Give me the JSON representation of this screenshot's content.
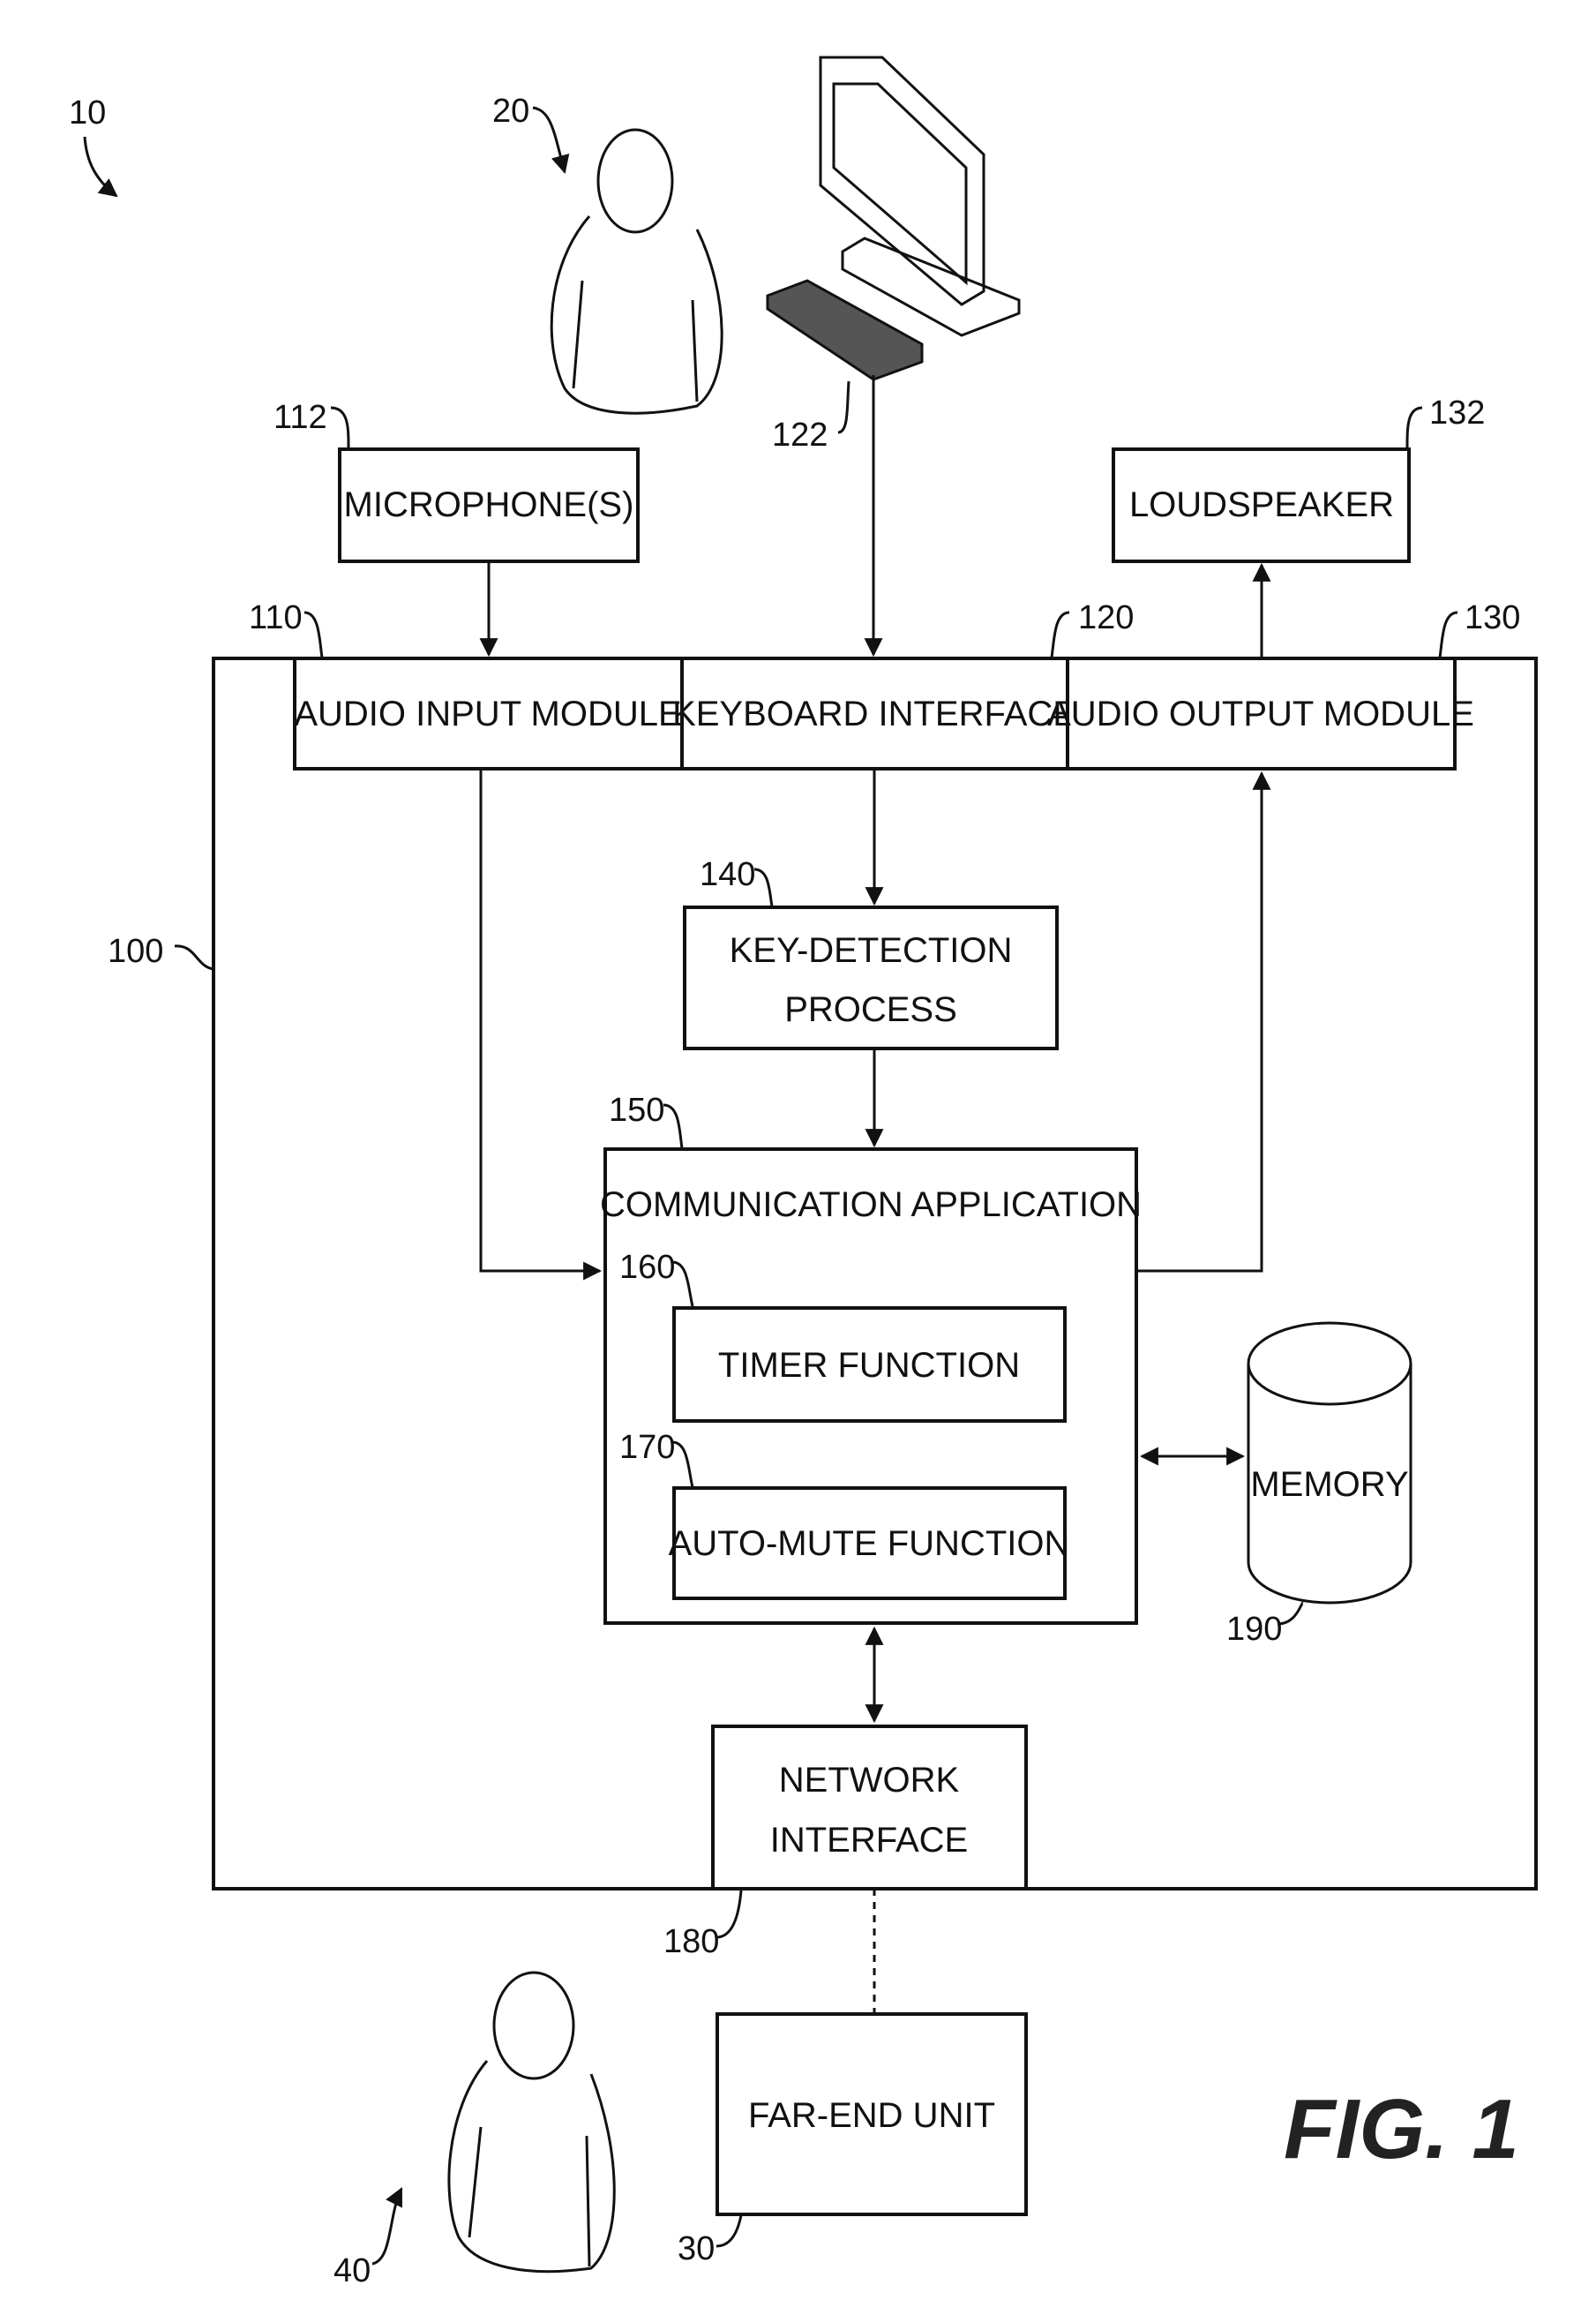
{
  "figure": {
    "title": "FIG. 1",
    "system_ref": "10"
  },
  "actors": {
    "near_end_user": {
      "ref": "20"
    },
    "far_end_user": {
      "ref": "40"
    },
    "computer_keyboard": {
      "ref": "122"
    }
  },
  "blocks": {
    "device": {
      "ref": "100"
    },
    "microphone": {
      "ref": "112",
      "label": "MICROPHONE(S)"
    },
    "loudspeaker": {
      "ref": "132",
      "label": "LOUDSPEAKER"
    },
    "audio_input": {
      "ref": "110",
      "label": "AUDIO INPUT MODULE"
    },
    "keyboard_interface": {
      "ref": "120",
      "label": "KEYBOARD INTERFACE"
    },
    "audio_output": {
      "ref": "130",
      "label": "AUDIO OUTPUT MODULE"
    },
    "key_detection": {
      "ref": "140",
      "line1": "KEY-DETECTION",
      "line2": "PROCESS"
    },
    "communication_app": {
      "ref": "150",
      "label": "COMMUNICATION APPLICATION"
    },
    "timer": {
      "ref": "160",
      "label": "TIMER FUNCTION"
    },
    "auto_mute": {
      "ref": "170",
      "label": "AUTO-MUTE FUNCTION"
    },
    "memory": {
      "ref": "190",
      "label": "MEMORY"
    },
    "network_interface": {
      "ref": "180",
      "line1": "NETWORK",
      "line2": "INTERFACE"
    },
    "far_end_unit": {
      "ref": "30",
      "label": "FAR-END UNIT"
    }
  }
}
